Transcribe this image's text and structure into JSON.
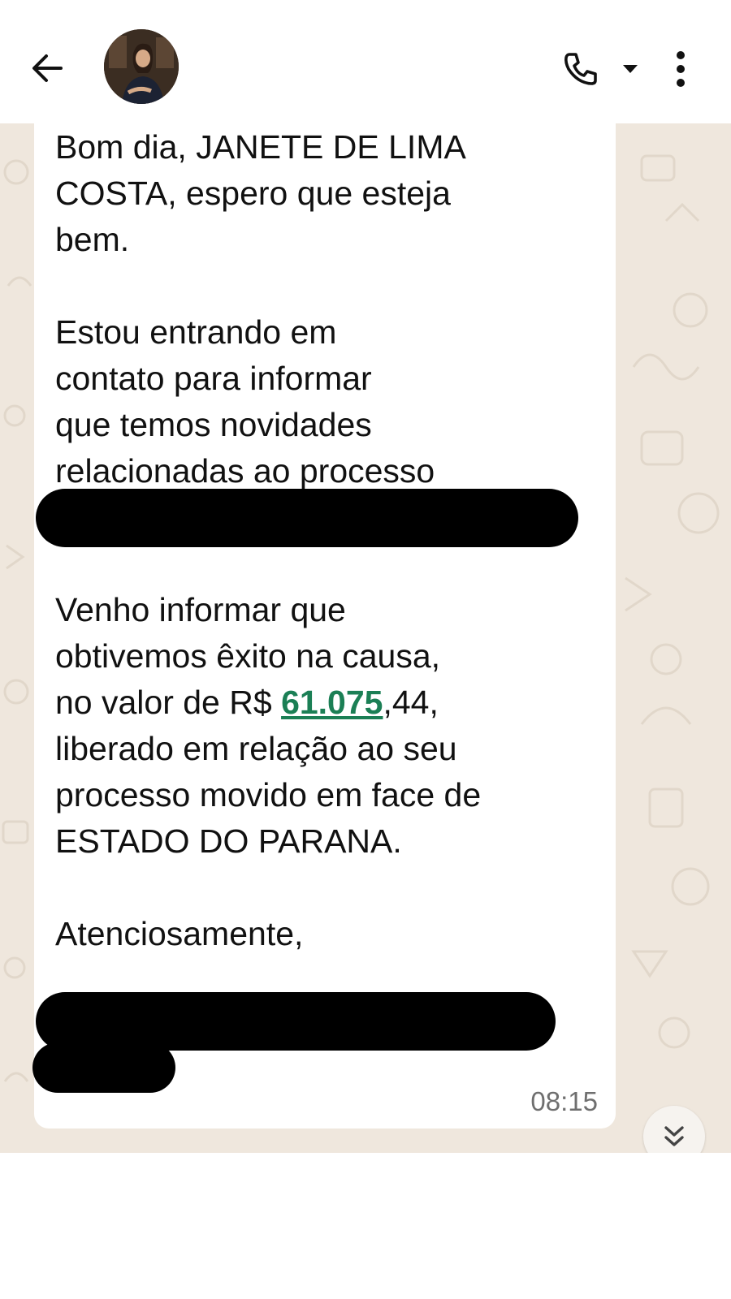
{
  "header": {
    "back_icon": "arrow-left-icon",
    "avatar_icon": "contact-avatar",
    "call_icon": "phone-icon",
    "call_dropdown_icon": "caret-down-icon",
    "more_icon": "more-vertical-icon"
  },
  "message": {
    "para1_line1": "Bom dia, JANETE DE LIMA",
    "para1_line2": "COSTA, espero que esteja",
    "para1_line3": "bem.",
    "para2_line1": "Estou entrando em",
    "para2_line2": "contato para informar",
    "para2_line3": "que temos novidades",
    "para2_line4": "relacionadas ao processo",
    "para3_line1": "Venho informar que",
    "para3_line2": "obtivemos êxito na causa,",
    "para3_line3_prefix": "no valor de R$ ",
    "para3_line3_link": "61.075",
    "para3_line3_suffix": ",44,",
    "para3_line4": "liberado em relação ao seu",
    "para3_line5": "processo movido em face de",
    "para3_line6": "ESTADO DO PARANA.",
    "closing": "Atenciosamente,",
    "time": "08:15"
  },
  "colors": {
    "link_green": "#1b7f55",
    "chat_background": "#efe7dd",
    "bubble": "#ffffff",
    "redaction": "#000000"
  },
  "scroll_down_icon": "double-chevron-down-icon"
}
